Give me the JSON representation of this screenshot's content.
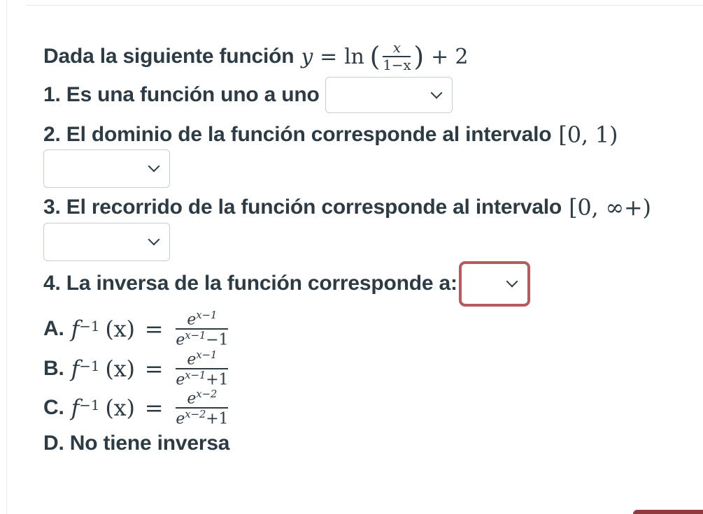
{
  "intro": {
    "text": "Dada la siguiente función",
    "formula": {
      "y": "y",
      "eq": "=",
      "ln": "ln",
      "lp": "(",
      "num": "x",
      "den": "1−x",
      "rp": ")",
      "plus": "+ 2"
    }
  },
  "q1": {
    "text": "1. Es una función uno a uno"
  },
  "q2": {
    "text": "2. El dominio de la función corresponde al intervalo",
    "interval": "[0, 1)"
  },
  "q3": {
    "text": "3. El recorrido de la función corresponde al intervalo",
    "interval": "[0, ∞+)"
  },
  "q4": {
    "text": "4. La inversa de la función corresponde a:"
  },
  "options": [
    {
      "label": "A.",
      "lhs": "f",
      "sup": "−1",
      "arg": "(x)",
      "eq": "=",
      "num": "e",
      "num_exp": "x−1",
      "den": "e",
      "den_exp": "x−1",
      "den_tail": "−1"
    },
    {
      "label": "B.",
      "lhs": "f",
      "sup": "−1",
      "arg": "(x)",
      "eq": "=",
      "num": "e",
      "num_exp": "x−1",
      "den": "e",
      "den_exp": "x−1",
      "den_tail": "+1"
    },
    {
      "label": "C.",
      "lhs": "f",
      "sup": "−1",
      "arg": "(x)",
      "eq": "=",
      "num": "e",
      "num_exp": "x−2",
      "den": "e",
      "den_exp": "x−2",
      "den_tail": "+1"
    },
    {
      "label": "D. No tiene inversa"
    }
  ],
  "selects": {
    "q1_value": "",
    "q2_value": "",
    "q3_value": "",
    "q4_value": "",
    "icon": "chevron-down-icon"
  },
  "colors": {
    "text": "#2d3b45",
    "focus_border": "#b85b5f",
    "select_border": "#c7cdd1",
    "corner_button": "#8e3a3f"
  }
}
